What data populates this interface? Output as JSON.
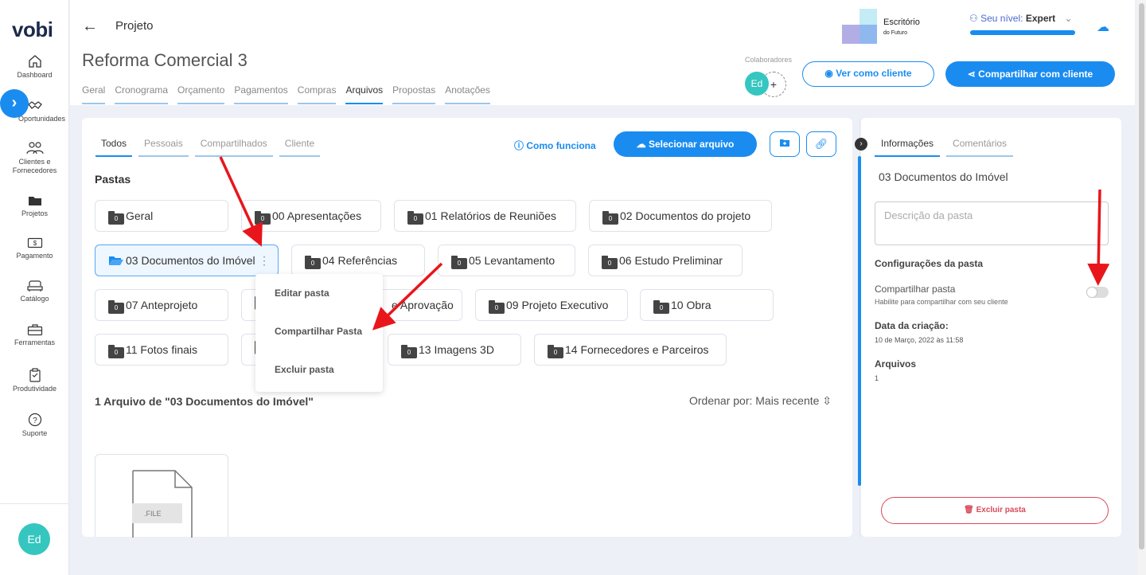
{
  "brand": {
    "logo": "vobi"
  },
  "sidebar": {
    "items": [
      {
        "label": "Dashboard",
        "icon": "home-icon"
      },
      {
        "label": "Oportunidades",
        "icon": "handshake-icon"
      },
      {
        "label": "Clientes e Fornecedores",
        "icon": "users-icon"
      },
      {
        "label": "Projetos",
        "icon": "folder-icon"
      },
      {
        "label": "Pagamento",
        "icon": "money-icon"
      },
      {
        "label": "Catálogo",
        "icon": "sofa-icon"
      },
      {
        "label": "Ferramentas",
        "icon": "toolbox-icon"
      },
      {
        "label": "Produtividade",
        "icon": "clipboard-icon"
      },
      {
        "label": "Suporte",
        "icon": "help-icon"
      }
    ],
    "avatar": "Ed"
  },
  "header": {
    "crumb": "Projeto",
    "project_title": "Reforma Comercial 3",
    "tabs": [
      "Geral",
      "Cronograma",
      "Orçamento",
      "Pagamentos",
      "Compras",
      "Arquivos",
      "Propostas",
      "Anotações"
    ],
    "active_tab": "Arquivos",
    "company_name": "Escritório",
    "company_sub": "do Futuro",
    "level_prefix": "Seu nível:",
    "level_value": "Expert",
    "level_progress": 1.0,
    "collab_label": "Colaboradores",
    "collab_avatar": "Ed",
    "collab_add": "+",
    "view_as_client": "Ver como cliente",
    "share_with_client": "Compartilhar com cliente"
  },
  "files": {
    "subtabs": [
      "Todos",
      "Pessoais",
      "Compartilhados",
      "Cliente"
    ],
    "active_subtab": "Todos",
    "how_it_works": "Como funciona",
    "select_file": "Selecionar arquivo",
    "pastas_title": "Pastas",
    "folders": [
      {
        "count": "0",
        "name": "Geral"
      },
      {
        "count": "0",
        "name": "00 Apresentações"
      },
      {
        "count": "0",
        "name": "01 Relatórios de Reuniões"
      },
      {
        "count": "0",
        "name": "02 Documentos do projeto"
      },
      {
        "count": "",
        "name": "03 Documentos do Imóvel"
      },
      {
        "count": "0",
        "name": "04 Referências"
      },
      {
        "count": "0",
        "name": "05 Levantamento"
      },
      {
        "count": "0",
        "name": "06 Estudo Preliminar"
      },
      {
        "count": "0",
        "name": "07 Anteprojeto"
      },
      {
        "count": "",
        "name": "e Aprovação"
      },
      {
        "count": "0",
        "name": "09 Projeto Executivo"
      },
      {
        "count": "0",
        "name": "10 Obra"
      },
      {
        "count": "0",
        "name": "11 Fotos finais"
      },
      {
        "count": "0",
        "name": "13 Imagens 3D"
      },
      {
        "count": "0",
        "name": "14 Fornecedores e Parceiros"
      }
    ],
    "menu": [
      "Editar pasta",
      "Compartilhar Pasta",
      "Excluir pasta"
    ],
    "files_title": "1 Arquivo de \"03 Documentos do Imóvel\"",
    "order_by": "Ordenar por: Mais recente",
    "file_ext": ".FILE"
  },
  "info": {
    "tabs": [
      "Informações",
      "Comentários"
    ],
    "folder_name": "03 Documentos do Imóvel",
    "desc_placeholder": "Descrição da pasta",
    "cfg_title": "Configurações  da pasta",
    "share_label": "Compartilhar pasta",
    "share_hint": "Habilite para compartilhar com seu cliente",
    "share_enabled": false,
    "created_label": "Data da criação:",
    "created_value": "10 de Março, 2022 às 11:58",
    "files_label": "Arquivos",
    "files_value": "1",
    "delete_btn": "Excluir pasta"
  },
  "colors": {
    "accent": "#1a8cf0",
    "danger": "#d94a5a",
    "annotation": "#e8161b"
  }
}
